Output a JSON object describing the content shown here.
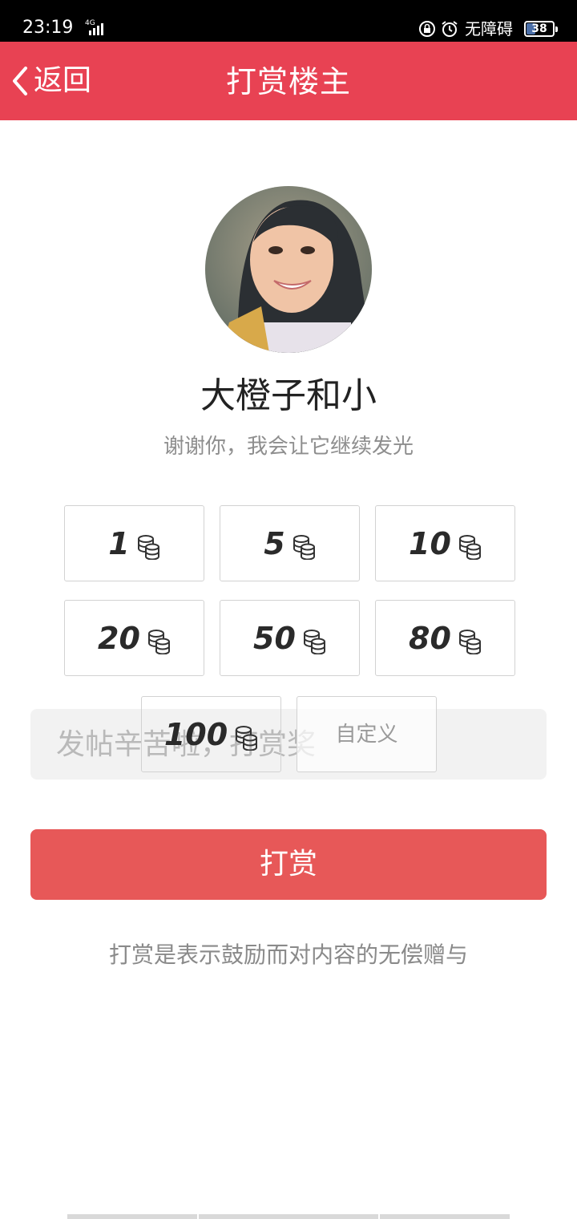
{
  "status_bar": {
    "time": "23:19",
    "network": "4G",
    "accessibility": "无障碍",
    "battery": "38",
    "battery_percent": 38
  },
  "header": {
    "back_label": "返回",
    "title": "打赏楼主"
  },
  "profile": {
    "username": "大橙子和小",
    "thanks_text": "谢谢你，我会让它继续发光"
  },
  "amounts": [
    {
      "value": "1"
    },
    {
      "value": "5"
    },
    {
      "value": "10"
    },
    {
      "value": "20"
    },
    {
      "value": "50"
    },
    {
      "value": "80"
    },
    {
      "value": "100"
    }
  ],
  "custom_label": "自定义",
  "message": {
    "placeholder": "发帖辛苦啦，打赏奖"
  },
  "reward_button_label": "打赏",
  "disclaimer": "打赏是表示鼓励而对内容的无偿赠与",
  "colors": {
    "header_bg": "#e84253",
    "button_bg": "#e75858"
  }
}
